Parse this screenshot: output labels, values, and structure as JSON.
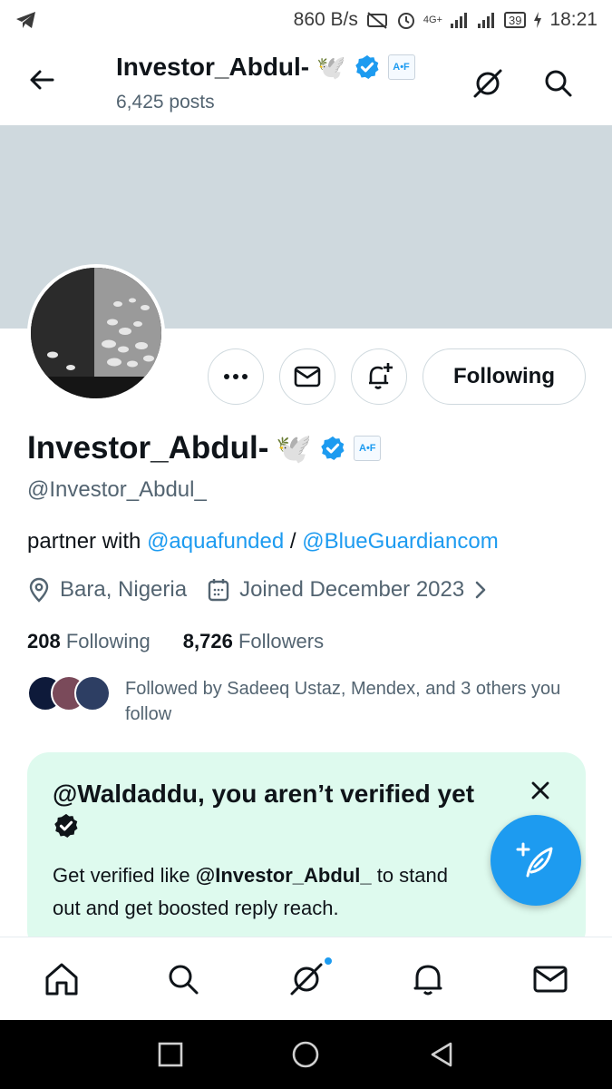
{
  "status_bar": {
    "speed": "860 B/s",
    "network_small": "4G+",
    "battery": "39",
    "time": "18:21",
    "icons": [
      "telegram-icon",
      "no-sim-icon",
      "alarm-icon",
      "signal-icon",
      "signal-icon",
      "battery-icon"
    ]
  },
  "header": {
    "display_name": "Investor_Abdul-",
    "emoji": "🕊️",
    "affiliate_badge": "A•F",
    "posts": "6,425 posts"
  },
  "profile": {
    "display_name": "Investor_Abdul-",
    "emoji": "🕊️",
    "affiliate_badge": "A•F",
    "handle": "@Investor_Abdul_",
    "bio_prefix": "partner with",
    "bio_link1": "@aquafunded",
    "bio_sep": "/",
    "bio_link2": "@BlueGuardiancom",
    "location": "Bara, Nigeria",
    "joined": "Joined December 2023",
    "following_count": "208",
    "following_label": "Following",
    "followers_count": "8,726",
    "followers_label": "Followers",
    "followed_by": "Followed by Sadeeq Ustaz, Mendex, and 3 others you follow"
  },
  "actions": {
    "following_button": "Following"
  },
  "verify_card": {
    "title": "@Waldaddu, you aren’t verified yet",
    "body_prefix": "Get verified like",
    "body_handle": "@Investor_Abdul_",
    "body_suffix": "to stand out and get boosted reply reach."
  },
  "colors": {
    "accent": "#1d9bf0",
    "banner": "#cfd9de",
    "card_bg": "#defaee",
    "secondary_text": "#536471"
  }
}
